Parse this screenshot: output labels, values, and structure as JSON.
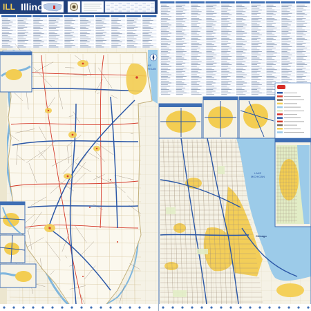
{
  "poster": {
    "title": "Illinois",
    "title_prefix": "ILL"
  },
  "lake": {
    "name_line1": "LAKE",
    "name_line2": "MICHIGAN",
    "north_label": "LAKE",
    "north_label2": "MICHIGAN"
  },
  "cities": {
    "chicago": "Chicago"
  },
  "index_columns": 20,
  "colors": {
    "title_band": "#1f3f7a",
    "index_header": "#3f6fb4",
    "index_row_a": "#ffffff",
    "index_row_b": "#e9eef7",
    "land": "#f5f2e6",
    "state_fill": "#fbf8ee",
    "water": "#9ccbe9",
    "urban": "#f3cd52",
    "interstate": "#2b57a6",
    "us_highway": "#d53b2b",
    "state_road": "#7a6a58",
    "county_line": "#b8a27a",
    "border": "#3f6fb4",
    "logo_red": "#d62d27"
  },
  "icons": {
    "compass": "compass-icon",
    "us_locator": "us-locator-icon",
    "seal": "state-seal-icon",
    "legend": "legend-icon",
    "logo": "publisher-logo-icon"
  }
}
